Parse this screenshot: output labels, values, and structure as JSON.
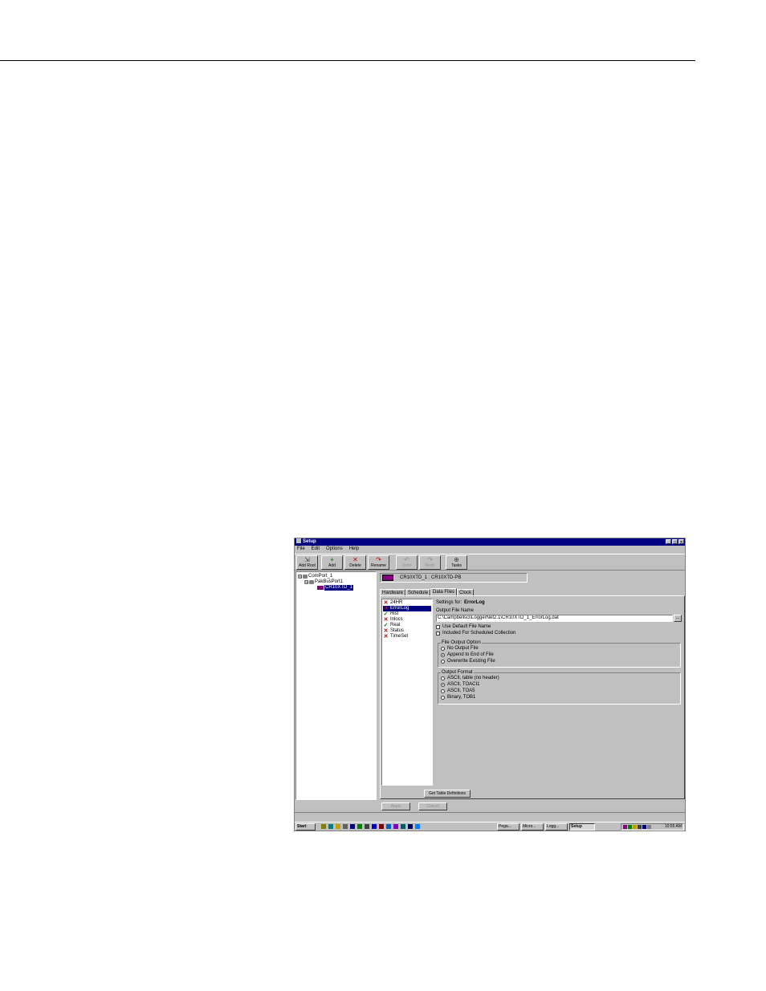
{
  "window": {
    "title": "Setup",
    "controls": {
      "minimize": "_",
      "maximize": "□",
      "close": "×"
    }
  },
  "menu": [
    "File",
    "Edit",
    "Options",
    "Help"
  ],
  "toolbar": [
    {
      "label": "Add Root",
      "icon": "add-root-icon",
      "enabled": true
    },
    {
      "label": "Add",
      "icon": "add-icon",
      "enabled": true
    },
    {
      "label": "Delete",
      "icon": "delete-icon",
      "enabled": true
    },
    {
      "label": "Rename",
      "icon": "rename-icon",
      "enabled": true
    },
    {
      "label": "Undo",
      "icon": "undo-icon",
      "enabled": false
    },
    {
      "label": "Redo",
      "icon": "redo-icon",
      "enabled": false
    },
    {
      "label": "Tasks",
      "icon": "tasks-icon",
      "enabled": true
    }
  ],
  "tree": [
    {
      "label": "ComPort_1",
      "icon": "port-icon",
      "expand": "⊟"
    },
    {
      "label": "PakBusPort1",
      "icon": "pakbus-icon",
      "expand": "⊟"
    },
    {
      "label": "CR10XTD_1",
      "icon": "datalogger-icon",
      "selected": true
    }
  ],
  "device_header": {
    "label": "CR10XTD_1 : CR10XTD-PB"
  },
  "tabs": [
    {
      "label": "Hardware",
      "active": false
    },
    {
      "label": "Schedule",
      "active": false
    },
    {
      "label": "Data Files",
      "active": true
    },
    {
      "label": "Clock",
      "active": false
    }
  ],
  "tables": [
    {
      "name": "24HR",
      "collected": false
    },
    {
      "name": "ErrorLog",
      "collected": false,
      "selected": true
    },
    {
      "name": "Hist",
      "collected": true
    },
    {
      "name": "Inlocs",
      "collected": false
    },
    {
      "name": "Real",
      "collected": true
    },
    {
      "name": "Status",
      "collected": false
    },
    {
      "name": "TimeSet",
      "collected": false
    }
  ],
  "settings": {
    "settings_for_label": "Settings for:",
    "settings_for_value": "ErrorLog",
    "output_file_name_label": "Output File Name",
    "output_file_name_value": "C:\\Campbellsci\\LoggerNet2.1\\CR10XTD_1_ErrorLog.dat",
    "browse_label": "...",
    "use_default_file_name": {
      "label": "Use Default File Name",
      "checked": false
    },
    "included_for_scheduled": {
      "label": "Included For Scheduled Collection",
      "checked": false
    },
    "file_output_option": {
      "title": "File Output Option",
      "options": [
        {
          "label": "No Output File",
          "selected": false
        },
        {
          "label": "Append to End of File",
          "selected": true
        },
        {
          "label": "Overwrite Existing File",
          "selected": false
        }
      ]
    },
    "output_format": {
      "title": "Output Format",
      "options": [
        {
          "label": "ASCII, table (no header)",
          "selected": false
        },
        {
          "label": "ASCII, TOACI1",
          "selected": true
        },
        {
          "label": "ASCII, TOA5",
          "selected": false
        },
        {
          "label": "Binary, TOB1",
          "selected": false
        }
      ]
    },
    "get_table_definitions": "Get Table Definitions"
  },
  "buttons": {
    "apply": "Apply",
    "cancel": "Cancel"
  },
  "taskbar": {
    "start": "Start",
    "tasks": [
      {
        "label": "Pega...",
        "active": false
      },
      {
        "label": "Micro...",
        "active": false
      },
      {
        "label": "Logg...",
        "active": false
      },
      {
        "label": "Setup",
        "active": true
      }
    ],
    "clock": "10:55 AM"
  },
  "colors": {
    "title_bar": "#000080",
    "selection": "#000080",
    "face": "#c0c0c0",
    "x_mark": "#c00000",
    "check_mark": "#008000"
  }
}
